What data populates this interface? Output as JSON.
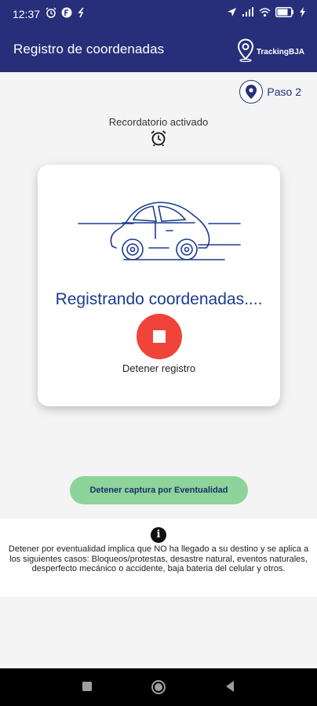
{
  "status_bar": {
    "time": "12:37",
    "left_icons": [
      "alarm-icon",
      "f-icon",
      "flash-icon"
    ],
    "right_icons": [
      "location-icon",
      "signal-icon",
      "wifi-icon",
      "battery-icon",
      "charging-icon"
    ]
  },
  "app_bar": {
    "title": "Registro de coordenadas",
    "brand": "TrackingBJA",
    "brand_icon": "location-pin-icon"
  },
  "step": {
    "label": "Paso 2",
    "icon": "location-pin-icon"
  },
  "reminder": {
    "label": "Recordatorio activado",
    "icon": "alarm-clock-icon"
  },
  "card": {
    "illustration": "car-icon",
    "status": "Registrando coordenadas....",
    "stop_icon": "stop-icon",
    "stop_label": "Detener registro"
  },
  "event_button": {
    "label": "Detener captura por Eventualidad"
  },
  "info": {
    "icon": "info-icon",
    "icon_glyph": "i",
    "text": "Detener por eventualidad implica que NO ha llegado a su destino y se aplica a los siguientes casos: Bloqueos/protestas, desastre natural, eventos naturales, desperfecto mecánico o accidente, baja bateria del celular y otros."
  },
  "nav_bar": {
    "buttons": [
      "recents-button",
      "home-button",
      "back-button"
    ]
  },
  "colors": {
    "primary": "#272f7a",
    "stop": "#f0443a",
    "event_button": "#8ed49a",
    "status_text": "#1a3c8f"
  }
}
